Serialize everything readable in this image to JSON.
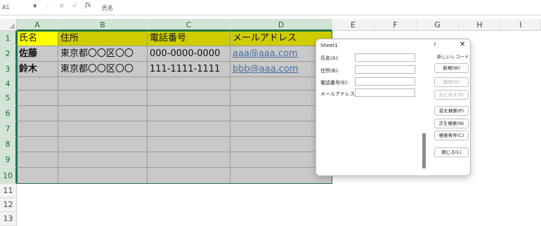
{
  "formula_bar": {
    "name_box": "A1",
    "cancel_icon": "×",
    "enter_icon": "✓",
    "fx": "fx",
    "value": "氏名"
  },
  "columns": [
    "A",
    "B",
    "C",
    "D",
    "E",
    "F",
    "G",
    "H",
    "I"
  ],
  "rows": [
    "1",
    "2",
    "3",
    "4",
    "5",
    "6",
    "7",
    "8",
    "9",
    "10",
    "11",
    "12",
    "13"
  ],
  "table": {
    "headers": [
      "氏名",
      "住所",
      "電話番号",
      "メールアドレス"
    ],
    "records": [
      [
        "佐藤",
        "東京都〇〇区〇〇",
        "000-0000-0000",
        "aaa@aaa.com"
      ],
      [
        "鈴木",
        "東京都〇〇区〇〇",
        "111-1111-1111",
        "bbb@aaa.com"
      ]
    ]
  },
  "dialog": {
    "title": "Sheet1",
    "help": "?",
    "close": "✕",
    "record_indicator": "新しいレコード",
    "fields": [
      {
        "label": "氏名(A):",
        "value": ""
      },
      {
        "label": "住所(B):",
        "value": ""
      },
      {
        "label": "電話番号(E):",
        "value": ""
      },
      {
        "label": "メールアドレス(G):",
        "value": ""
      }
    ],
    "buttons": {
      "new": "新規(W)",
      "delete": "削除(D)",
      "restore": "元に戻す(R)",
      "find_prev": "前を検索(P)",
      "find_next": "次を検索(N)",
      "criteria": "検索条件(C)",
      "close": "閉じる(L)"
    }
  }
}
